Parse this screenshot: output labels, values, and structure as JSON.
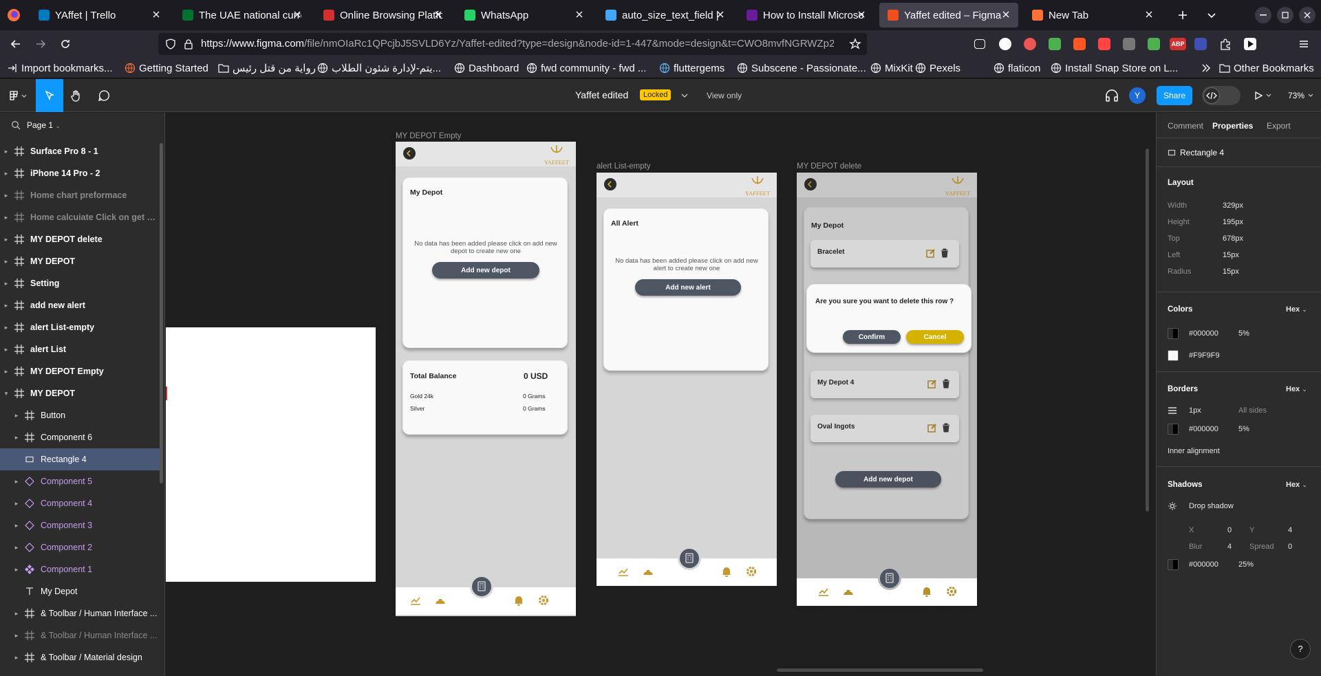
{
  "browser": {
    "tabs": [
      {
        "title": "YAffet | Trello",
        "icon": "trello-icon",
        "color": "#0079bf"
      },
      {
        "title": "The UAE national curre",
        "icon": "uae-flag-icon",
        "color": "#00732f"
      },
      {
        "title": "Online Browsing Platfo",
        "icon": "esc-icon",
        "color": "#d32f2f"
      },
      {
        "title": "WhatsApp",
        "icon": "whatsapp-icon",
        "color": "#25d366"
      },
      {
        "title": "auto_size_text_field |",
        "icon": "flutter-icon",
        "color": "#42a5f5"
      },
      {
        "title": "How to Install Microso",
        "icon": "site-icon",
        "color": "#6a1b9a"
      },
      {
        "title": "Yaffet edited – Figma",
        "icon": "figma-icon",
        "color": "#f24e1e"
      },
      {
        "title": "New Tab",
        "icon": "firefox-icon",
        "color": "#ff7139"
      }
    ],
    "url_host": "https://www.figma.com",
    "url_path": "/file/nmOIaRc1QPcjbJ5SVLD6Yz/Yaffet-edited?type=design&node-id=1-447&mode=design&t=CWO8mvfNGRWZp2"
  },
  "bookmarks": [
    "Import bookmarks...",
    "Getting Started",
    "رواية من قتل رئيس",
    "يتم-لإدارة شئون الطلاب...",
    "Dashboard",
    "fwd community - fwd ...",
    "fluttergems",
    "Subscene - Passionate...",
    "MixKit",
    "Pexels",
    "flaticon",
    "Install Snap Store on L..."
  ],
  "bookmarks_other": "Other Bookmarks",
  "figma": {
    "file_name": "Yaffet edited",
    "locked_badge": "Locked",
    "view_only": "View only",
    "share": "Share",
    "zoom": "73%",
    "avatar": "Y"
  },
  "left_panel": {
    "page": "Page 1",
    "layers": [
      {
        "name": "Surface Pro 8 - 1",
        "type": "frame",
        "style": "bold"
      },
      {
        "name": "iPhone 14 Pro - 2",
        "type": "frame",
        "style": "bold"
      },
      {
        "name": "Home chart preformace",
        "type": "frame",
        "style": "dim"
      },
      {
        "name": "Home calcuiate Click on get highe...",
        "type": "frame",
        "style": "dim"
      },
      {
        "name": "MY DEPOT delete",
        "type": "frame",
        "style": "bold"
      },
      {
        "name": "MY DEPOT",
        "type": "frame",
        "style": "bold"
      },
      {
        "name": "Setting",
        "type": "frame",
        "style": "bold"
      },
      {
        "name": "add new alert",
        "type": "frame",
        "style": "bold"
      },
      {
        "name": "alert List-empty",
        "type": "frame",
        "style": "bold"
      },
      {
        "name": "alert List",
        "type": "frame",
        "style": "bold"
      },
      {
        "name": "MY DEPOT Empty",
        "type": "frame",
        "style": "bold"
      },
      {
        "name": "MY DEPOT",
        "type": "frame",
        "style": "bold-open"
      },
      {
        "name": "Button",
        "type": "frame",
        "style": "child"
      },
      {
        "name": "Component 6",
        "type": "frame",
        "style": "child"
      },
      {
        "name": "Rectangle 4",
        "type": "rect",
        "style": "child-sel"
      },
      {
        "name": "Component 5",
        "type": "instance",
        "style": "comp"
      },
      {
        "name": "Component 4",
        "type": "instance",
        "style": "comp"
      },
      {
        "name": "Component 3",
        "type": "instance",
        "style": "comp"
      },
      {
        "name": "Component 2",
        "type": "instance",
        "style": "comp"
      },
      {
        "name": "Component 1",
        "type": "component",
        "style": "comp"
      },
      {
        "name": "My Depot",
        "type": "text",
        "style": "child-noarrow"
      },
      {
        "name": "& Toolbar / Human Interface ...",
        "type": "frame",
        "style": "child"
      },
      {
        "name": "& Toolbar / Human Interface ...",
        "type": "frame",
        "style": "child-dim"
      },
      {
        "name": "& Toolbar / Material design",
        "type": "frame",
        "style": "child"
      }
    ]
  },
  "frames": {
    "depot_empty": {
      "label": "MY DEPOT Empty",
      "card_title": "My Depot",
      "empty_text": "No data  has been added please click on add new depot to create new one",
      "button": "Add new depot",
      "balance_title": "Total Balance",
      "balance_value": "0 USD",
      "gold_label": "Gold 24k",
      "gold_value": "0 Grams",
      "silver_label": "Silver",
      "silver_value": "0 Grams"
    },
    "alert_empty": {
      "label": "alert List-empty",
      "card_title": "All Alert",
      "empty_text": "No data has been added please click on add new alert to create new one",
      "button": "Add new alert"
    },
    "depot_delete": {
      "label": "MY DEPOT delete",
      "card_title": "My Depot",
      "rows": [
        "Bracelet",
        "My Depot 4",
        "Oval Ingots"
      ],
      "dialog_text": "Are you sure you want to delete this row ?",
      "confirm": "Confirm",
      "cancel": "Cancel",
      "button": "Add new depot"
    },
    "logo_text": "YAFFEET"
  },
  "right_panel": {
    "tabs": [
      "Comment",
      "Properties",
      "Export"
    ],
    "selection": "Rectangle 4",
    "layout_title": "Layout",
    "layout": [
      {
        "label": "Width",
        "value": "329px"
      },
      {
        "label": "Height",
        "value": "195px"
      },
      {
        "label": "Top",
        "value": "678px"
      },
      {
        "label": "Left",
        "value": "15px"
      },
      {
        "label": "Radius",
        "value": "15px"
      }
    ],
    "colors_title": "Colors",
    "hex": "Hex",
    "colors": [
      {
        "value": "#000000",
        "opacity": "5%"
      },
      {
        "value": "#F9F9F9",
        "opacity": ""
      }
    ],
    "borders_title": "Borders",
    "border_width": "1px",
    "border_sides": "All sides",
    "border_color": "#000000",
    "border_opacity": "5%",
    "inner_alignment": "Inner alignment",
    "shadows_title": "Shadows",
    "shadow_type": "Drop shadow",
    "shadow": {
      "x_label": "X",
      "x": "0",
      "y_label": "Y",
      "y": "4",
      "blur_label": "Blur",
      "blur": "4",
      "spread_label": "Spread",
      "spread": "0"
    },
    "shadow_color": "#000000",
    "shadow_opacity": "25%"
  },
  "help": "?"
}
